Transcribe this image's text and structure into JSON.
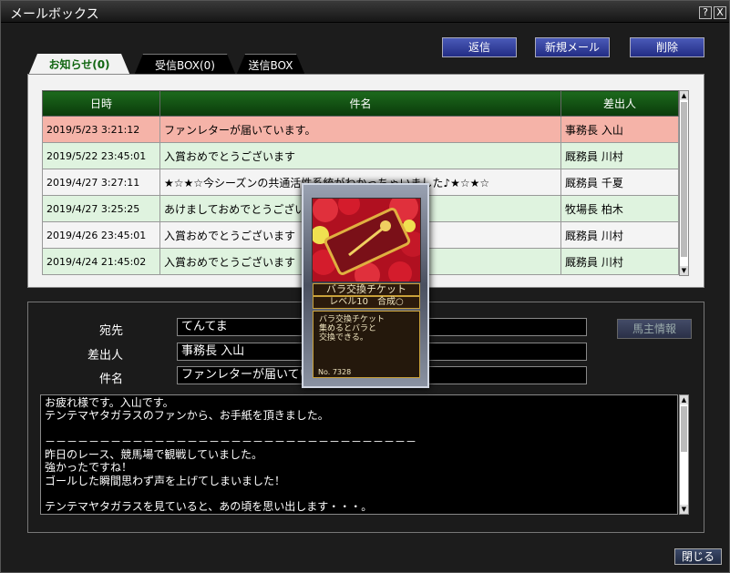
{
  "window": {
    "title": "メールボックス",
    "help_label": "?",
    "close_label": "X"
  },
  "tabs": [
    {
      "label": "お知らせ(0)"
    },
    {
      "label": "受信BOX(0)"
    },
    {
      "label": "送信BOX"
    }
  ],
  "toolbar": {
    "reply_label": "返信",
    "new_label": "新規メール",
    "delete_label": "削除"
  },
  "table": {
    "headers": {
      "date": "日時",
      "subject": "件名",
      "sender": "差出人"
    },
    "rows": [
      {
        "date": "2019/5/23 3:21:12",
        "subject": "ファンレターが届いています。",
        "sender": "事務長 入山"
      },
      {
        "date": "2019/5/22 23:45:01",
        "subject": "入賞おめでとうございます",
        "sender": "厩務員 川村"
      },
      {
        "date": "2019/4/27 3:27:11",
        "subject": "★☆★☆今シーズンの共通活性系統がわかっちゃいました♪★☆★☆",
        "sender": "厩務員 千夏"
      },
      {
        "date": "2019/4/27 3:25:25",
        "subject": "あけましておめでとうございま",
        "sender": "牧場長 柏木"
      },
      {
        "date": "2019/4/26 23:45:01",
        "subject": "入賞おめでとうございます",
        "sender": "厩務員 川村"
      },
      {
        "date": "2019/4/24 21:45:02",
        "subject": "入賞おめでとうございます",
        "sender": "厩務員 川村"
      }
    ]
  },
  "detail": {
    "to_label": "宛先",
    "to_value": "てんてま",
    "from_label": "差出人",
    "from_value": "事務長 入山",
    "subject_label": "件名",
    "subject_value": "ファンレターが届いてい",
    "owner_info_label": "馬主情報",
    "body": "お疲れ様です。入山です。\nテンテマヤタガラスのファンから、お手紙を頂きました。\n\n－－－－－－－－－－－－－－－－－－－－－－－－－－－－－－－－－－\n昨日のレース、競馬場で観戦していました。\n強かったですね！\nゴールした瞬間思わず声を上げてしまいました！\n\nテンテマヤタガラスを見ていると、あの頃を思い出します・・・。"
  },
  "card": {
    "name": "バラ交換チケット",
    "level": "レベル10　合成○",
    "description": "バラ交換チケット\n集めるとバラと\n交換できる。",
    "number": "No. 7328"
  },
  "footer": {
    "close_label": "閉じる"
  }
}
